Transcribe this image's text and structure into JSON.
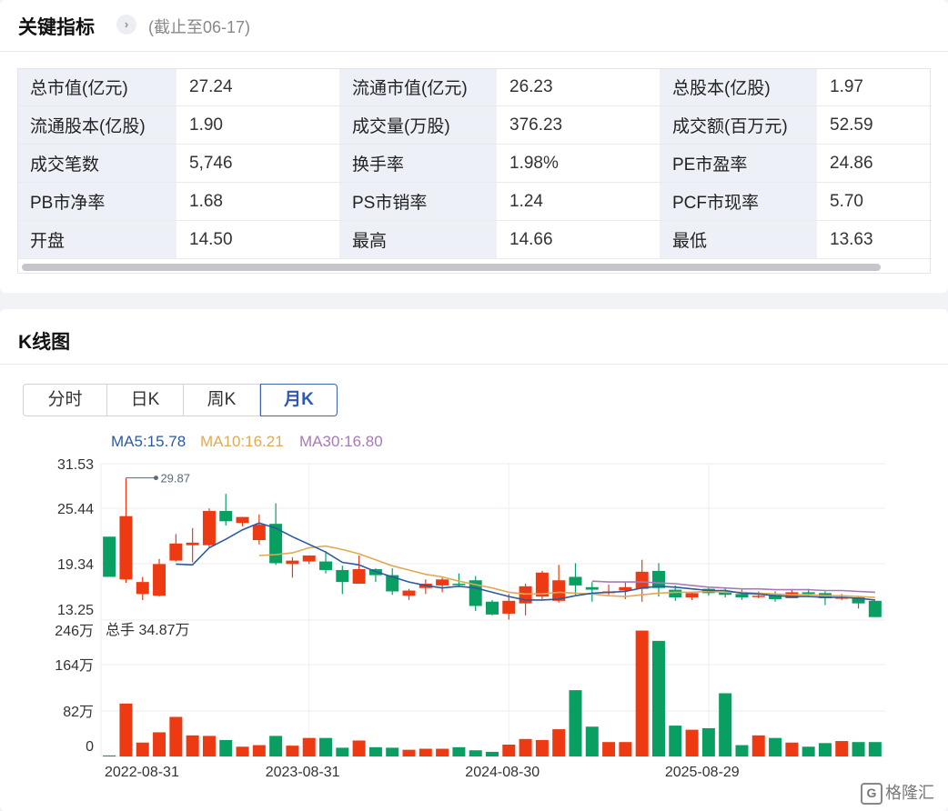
{
  "metrics_section": {
    "title": "关键指标",
    "chevron": "›",
    "as_of": "(截止至06-17)",
    "rows": [
      [
        {
          "label": "总市值(亿元)",
          "value": "27.24"
        },
        {
          "label": "流通市值(亿元)",
          "value": "26.23"
        },
        {
          "label": "总股本(亿股)",
          "value": "1.97"
        }
      ],
      [
        {
          "label": "流通股本(亿股)",
          "value": "1.90"
        },
        {
          "label": "成交量(万股)",
          "value": "376.23"
        },
        {
          "label": "成交额(百万元)",
          "value": "52.59"
        }
      ],
      [
        {
          "label": "成交笔数",
          "value": "5,746"
        },
        {
          "label": "换手率",
          "value": "1.98%"
        },
        {
          "label": "PE市盈率",
          "value": "24.86"
        }
      ],
      [
        {
          "label": "PB市净率",
          "value": "1.68"
        },
        {
          "label": "PS市销率",
          "value": "1.24"
        },
        {
          "label": "PCF市现率",
          "value": "5.70"
        }
      ],
      [
        {
          "label": "开盘",
          "value": "14.50"
        },
        {
          "label": "最高",
          "value": "14.66"
        },
        {
          "label": "最低",
          "value": "13.63"
        }
      ]
    ]
  },
  "kline_section": {
    "title": "K线图",
    "tabs": [
      "分时",
      "日K",
      "周K",
      "月K"
    ],
    "active_tab": "月K",
    "ma5_label": "MA5:15.78",
    "ma10_label": "MA10:16.21",
    "ma30_label": "MA30:16.80"
  },
  "watermark": {
    "symbol": "G",
    "text": "格隆汇"
  },
  "colors": {
    "up": "#ee3a13",
    "down": "#0a9f62",
    "ma5": "#2c5aa0",
    "ma10": "#e0a955",
    "ma30": "#a67ab8",
    "active_tab": "#2f58b5",
    "label_bg": "#eef0f8"
  },
  "chart_data": {
    "type": "candlestick",
    "y_ticks": [
      "31.53",
      "25.44",
      "19.34",
      "13.25"
    ],
    "ylim": [
      13.25,
      31.53
    ],
    "max_annotation": "29.87",
    "volume_label": "总手 34.87万",
    "volume_ticks": [
      "246万",
      "164万",
      "82万",
      "0"
    ],
    "volume_max": 246,
    "x_ticks": [
      {
        "index": 0,
        "label": "2022-08-31"
      },
      {
        "index": 12,
        "label": "2023-08-31"
      },
      {
        "index": 24,
        "label": "2024-08-30"
      },
      {
        "index": 36,
        "label": "2025-08-29"
      }
    ],
    "candles": [
      {
        "o": 23.0,
        "h": 23.0,
        "l": 18.3,
        "c": 18.3,
        "v": 2
      },
      {
        "o": 18.0,
        "h": 29.87,
        "l": 17.6,
        "c": 25.4,
        "v": 103
      },
      {
        "o": 16.3,
        "h": 18.3,
        "l": 15.6,
        "c": 17.7,
        "v": 27
      },
      {
        "o": 16.1,
        "h": 20.4,
        "l": 16.0,
        "c": 19.8,
        "v": 47
      },
      {
        "o": 20.2,
        "h": 23.3,
        "l": 20.1,
        "c": 22.2,
        "v": 77
      },
      {
        "o": 22.0,
        "h": 24.0,
        "l": 20.0,
        "c": 22.3,
        "v": 41
      },
      {
        "o": 22.0,
        "h": 26.3,
        "l": 21.8,
        "c": 26.0,
        "v": 40
      },
      {
        "o": 26.0,
        "h": 28.0,
        "l": 24.3,
        "c": 24.8,
        "v": 32
      },
      {
        "o": 24.6,
        "h": 25.3,
        "l": 24.2,
        "c": 25.3,
        "v": 19
      },
      {
        "o": 22.6,
        "h": 25.6,
        "l": 22.1,
        "c": 24.4,
        "v": 22
      },
      {
        "o": 24.5,
        "h": 26.9,
        "l": 19.7,
        "c": 19.9,
        "v": 40
      },
      {
        "o": 19.8,
        "h": 20.6,
        "l": 18.2,
        "c": 20.2,
        "v": 21
      },
      {
        "o": 20.1,
        "h": 20.8,
        "l": 19.8,
        "c": 20.8,
        "v": 36
      },
      {
        "o": 20.1,
        "h": 21.3,
        "l": 18.7,
        "c": 19.1,
        "v": 36
      },
      {
        "o": 19.1,
        "h": 19.6,
        "l": 16.3,
        "c": 17.7,
        "v": 17
      },
      {
        "o": 17.5,
        "h": 20.8,
        "l": 17.5,
        "c": 19.2,
        "v": 31
      },
      {
        "o": 19.2,
        "h": 19.3,
        "l": 17.7,
        "c": 18.5,
        "v": 18
      },
      {
        "o": 18.5,
        "h": 19.3,
        "l": 16.2,
        "c": 16.6,
        "v": 17
      },
      {
        "o": 16.1,
        "h": 16.9,
        "l": 15.6,
        "c": 16.7,
        "v": 13
      },
      {
        "o": 17.0,
        "h": 18.0,
        "l": 16.3,
        "c": 17.5,
        "v": 15
      },
      {
        "o": 17.3,
        "h": 18.2,
        "l": 16.5,
        "c": 18.0,
        "v": 15
      },
      {
        "o": 17.5,
        "h": 18.7,
        "l": 17.1,
        "c": 17.4,
        "v": 18
      },
      {
        "o": 17.9,
        "h": 18.4,
        "l": 14.3,
        "c": 14.9,
        "v": 12
      },
      {
        "o": 15.4,
        "h": 15.6,
        "l": 13.8,
        "c": 13.9,
        "v": 9
      },
      {
        "o": 14.0,
        "h": 16.3,
        "l": 13.3,
        "c": 15.5,
        "v": 23
      },
      {
        "o": 15.2,
        "h": 17.5,
        "l": 13.8,
        "c": 17.2,
        "v": 34
      },
      {
        "o": 16.0,
        "h": 19.0,
        "l": 15.7,
        "c": 18.8,
        "v": 32
      },
      {
        "o": 15.5,
        "h": 19.7,
        "l": 15.3,
        "c": 17.9,
        "v": 53
      },
      {
        "o": 18.3,
        "h": 19.9,
        "l": 16.2,
        "c": 17.3,
        "v": 129
      },
      {
        "o": 17.1,
        "h": 17.7,
        "l": 15.4,
        "c": 16.8,
        "v": 58
      },
      {
        "o": 16.4,
        "h": 17.4,
        "l": 16.2,
        "c": 16.6,
        "v": 28
      },
      {
        "o": 16.7,
        "h": 17.7,
        "l": 15.7,
        "c": 17.1,
        "v": 28
      },
      {
        "o": 16.9,
        "h": 20.3,
        "l": 15.4,
        "c": 18.9,
        "v": 245
      },
      {
        "o": 19.0,
        "h": 19.9,
        "l": 16.0,
        "c": 17.0,
        "v": 225
      },
      {
        "o": 16.8,
        "h": 17.3,
        "l": 15.5,
        "c": 15.9,
        "v": 60
      },
      {
        "o": 15.9,
        "h": 16.5,
        "l": 15.6,
        "c": 16.4,
        "v": 52
      },
      {
        "o": 16.9,
        "h": 17.0,
        "l": 16.1,
        "c": 16.4,
        "v": 55
      },
      {
        "o": 16.6,
        "h": 17.0,
        "l": 15.9,
        "c": 16.2,
        "v": 123
      },
      {
        "o": 16.3,
        "h": 16.8,
        "l": 15.6,
        "c": 15.9,
        "v": 22
      },
      {
        "o": 16.0,
        "h": 16.6,
        "l": 15.8,
        "c": 16.1,
        "v": 41
      },
      {
        "o": 16.2,
        "h": 16.6,
        "l": 15.4,
        "c": 15.7,
        "v": 36
      },
      {
        "o": 15.8,
        "h": 16.9,
        "l": 15.8,
        "c": 16.5,
        "v": 27
      },
      {
        "o": 16.5,
        "h": 16.9,
        "l": 16.1,
        "c": 16.3,
        "v": 19
      },
      {
        "o": 16.4,
        "h": 16.6,
        "l": 15.0,
        "c": 15.8,
        "v": 26
      },
      {
        "o": 15.8,
        "h": 16.3,
        "l": 15.6,
        "c": 15.9,
        "v": 30
      },
      {
        "o": 15.9,
        "h": 16.1,
        "l": 14.6,
        "c": 15.2,
        "v": 28
      },
      {
        "o": 15.5,
        "h": 15.5,
        "l": 13.6,
        "c": 13.6,
        "v": 28
      }
    ],
    "ma5": [
      null,
      null,
      null,
      null,
      19.8,
      19.7,
      21.7,
      22.7,
      23.8,
      24.6,
      24.0,
      23.0,
      22.1,
      21.2,
      20.0,
      19.7,
      18.9,
      18.3,
      17.7,
      17.3,
      17.0,
      17.2,
      17.0,
      16.5,
      16.0,
      15.6,
      15.6,
      15.7,
      16.1,
      16.4,
      16.5,
      16.6,
      17.0,
      17.2,
      17.1,
      16.9,
      16.7,
      16.7,
      16.4,
      16.3,
      16.1,
      16.0,
      16.0,
      15.9,
      15.9,
      15.8,
      15.6
    ],
    "ma10": [
      null,
      null,
      null,
      null,
      null,
      null,
      null,
      null,
      null,
      20.8,
      20.9,
      21.1,
      21.7,
      21.9,
      21.5,
      21.0,
      20.3,
      19.6,
      19.1,
      18.6,
      18.3,
      17.8,
      17.4,
      17.0,
      16.5,
      16.3,
      16.3,
      16.5,
      16.4,
      16.3,
      16.1,
      16.0,
      16.2,
      16.4,
      16.5,
      16.5,
      16.6,
      16.5,
      16.5,
      16.4,
      16.3,
      16.2,
      16.2,
      16.1,
      16.1,
      16.0,
      15.9
    ],
    "ma30": [
      null,
      null,
      null,
      null,
      null,
      null,
      null,
      null,
      null,
      null,
      null,
      null,
      null,
      null,
      null,
      null,
      null,
      null,
      null,
      null,
      null,
      null,
      null,
      null,
      null,
      null,
      null,
      null,
      null,
      17.8,
      17.7,
      17.7,
      17.7,
      17.6,
      17.5,
      17.3,
      17.1,
      17.0,
      16.9,
      16.9,
      16.8,
      16.8,
      16.8,
      16.7,
      16.7,
      16.6,
      16.5
    ]
  }
}
